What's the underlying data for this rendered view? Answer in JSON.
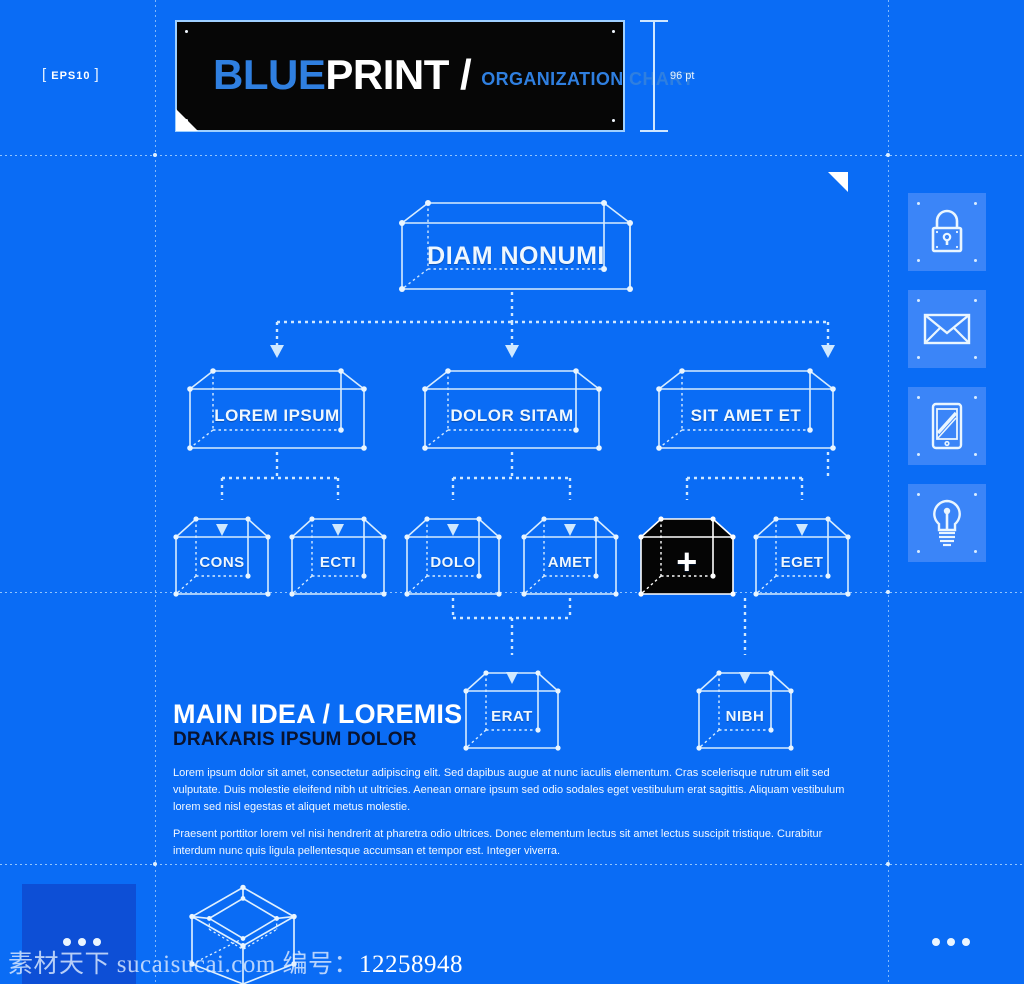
{
  "theme": {
    "background": "#0a6cf5",
    "banner_bg": "#060606",
    "accent_blue": "#2f7fe0",
    "wire_white": "#d7ecff",
    "tile_blue": "#3b85f8",
    "dark_navy": "#09132f",
    "highlight_cube": "#050505"
  },
  "header": {
    "eps_badge": "EPS10",
    "bracket_left": "[",
    "bracket_right": "]",
    "title_part1": "BLUE",
    "title_part2": "PRINT /",
    "subtitle": "ORGANIZATION CHART",
    "dimension_label": "96 pt"
  },
  "chart": {
    "root": {
      "label": "DIAM NONUMI"
    },
    "level2": [
      {
        "label": "LOREM IPSUM"
      },
      {
        "label": "DOLOR SITAM"
      },
      {
        "label": "SIT AMET ET"
      }
    ],
    "level3": [
      {
        "label": "CONS",
        "highlighted": false
      },
      {
        "label": "ECTI",
        "highlighted": false
      },
      {
        "label": "DOLO",
        "highlighted": false
      },
      {
        "label": "AMET",
        "highlighted": false
      },
      {
        "label": "+",
        "highlighted": true
      },
      {
        "label": "EGET",
        "highlighted": false
      }
    ],
    "level4": [
      {
        "label": "ERAT"
      },
      {
        "label": "NIBH"
      }
    ]
  },
  "main_idea": {
    "heading": "MAIN IDEA / LOREMIS",
    "subheading": "DRAKARIS IPSUM DOLOR",
    "paragraph1": "Lorem ipsum dolor sit amet, consectetur adipiscing elit. Sed dapibus augue at nunc iaculis elementum. Cras scelerisque rutrum elit sed vulputate. Duis molestie eleifend nibh ut ultricies. Aenean ornare ipsum sed odio sodales eget vestibulum erat sagittis. Aliquam vestibulum lorem sed nisl egestas et aliquet metus molestie.",
    "paragraph2": "Praesent porttitor lorem vel nisi hendrerit at pharetra odio ultrices. Donec elementum lectus sit amet lectus suscipit tristique. Curabitur interdum nunc quis ligula pellentesque accumsan et tempor est. Integer viverra."
  },
  "icon_rail": [
    {
      "icon": "lock-icon",
      "name": "security"
    },
    {
      "icon": "envelope-icon",
      "name": "mail"
    },
    {
      "icon": "tablet-icon",
      "name": "device"
    },
    {
      "icon": "lightbulb-icon",
      "name": "idea"
    }
  ],
  "watermark": {
    "site": "素材天下 sucaisucai.com",
    "id_label": "编号：",
    "id_value": "12258948"
  }
}
